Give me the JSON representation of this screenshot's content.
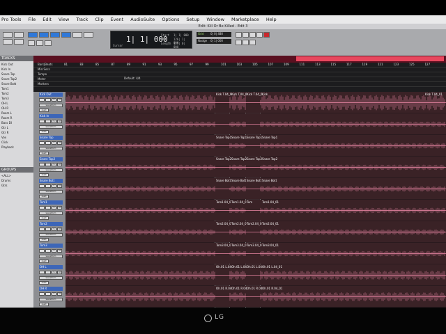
{
  "menu": {
    "items": [
      "Pro Tools",
      "File",
      "Edit",
      "View",
      "Track",
      "Clip",
      "Event",
      "AudioSuite",
      "Options",
      "Setup",
      "Window",
      "Marketplace",
      "Help"
    ]
  },
  "window": {
    "title": "Edit: Kill Or Be Killed - Edit 3"
  },
  "counter": {
    "main": "1| 1| 000",
    "cursor_label": "Cursor",
    "start_label": "Start",
    "end_label": "End",
    "length_label": "Length",
    "start_value": "1| 1| 000",
    "end_value": "126| 1| 000",
    "length_value": "125| 0| 000"
  },
  "nudge": {
    "label": "Nudge",
    "value": "0| 1| 000"
  },
  "grid": {
    "label": "Grid",
    "value": "0| 0| 480"
  },
  "tracks_panel": {
    "header": "TRACKS",
    "items": [
      "Kick Out",
      "Kick In",
      "Snare Top",
      "Snare Top2",
      "Snare Bott",
      "Tom1",
      "Tom2",
      "Tom3",
      "OH L",
      "OH R",
      "Room L",
      "Room R",
      "Bass DI",
      "Gtr L",
      "Gtr R",
      "Vox",
      "Click",
      "Playback"
    ]
  },
  "groups_panel": {
    "header": "GROUPS",
    "items": [
      "<ALL>",
      "Drums",
      "Gtrs"
    ]
  },
  "rulers": {
    "rows": [
      "Bars|Beats",
      "Min:Secs",
      "Tempo",
      "Meter",
      "Markers"
    ],
    "bar_numbers": [
      "81",
      "83",
      "85",
      "87",
      "89",
      "91",
      "93",
      "95",
      "97",
      "99",
      "101",
      "103",
      "105",
      "107",
      "109",
      "111",
      "113",
      "115",
      "117",
      "119",
      "121",
      "123",
      "125",
      "127"
    ],
    "marker": "Default: 4/4"
  },
  "tracks": [
    {
      "name": "Kick Out",
      "clips": [
        "Kick T.04_0",
        "Kick T.04_0",
        "Kick T.04_0",
        "Kick",
        "Kick T.04_01"
      ]
    },
    {
      "name": "Kick In",
      "clips": []
    },
    {
      "name": "Snare Top",
      "clips": [
        "Snare Top1",
        "Snare Top1",
        "Snare Top1",
        "Snare Top1"
      ]
    },
    {
      "name": "Snare Top2",
      "clips": [
        "Snare Top2",
        "Snare Top2",
        "Snare Top2",
        "Snare Top2"
      ]
    },
    {
      "name": "Snare Bott",
      "clips": [
        "Snare Bott",
        "Snare Bott",
        "Snare Bott",
        "Snare Bott"
      ]
    },
    {
      "name": "Tom1",
      "clips": [
        "Tom1.04_0",
        "Tom1.04_0",
        "Tom",
        "Tom1.04_01"
      ]
    },
    {
      "name": "Tom2",
      "clips": [
        "Tom2.04_0",
        "Tom2.04_0",
        "Tom2.04_0",
        "Tom2.04_01"
      ]
    },
    {
      "name": "Tom3",
      "clips": [
        "Tom3.04_0",
        "Tom3.04_0",
        "Tom3.04_0",
        "Tom3.04_01"
      ]
    },
    {
      "name": "OH L",
      "clips": [
        "Oh.01 L.04",
        "Oh.01 L.04",
        "Oh.01 L.04",
        "Oh.01 L.04_01"
      ]
    },
    {
      "name": "OH R",
      "clips": [
        "Oh.01 R.04",
        "Oh.01 R.04",
        "Oh.01 R.04",
        "Oh.01 R.04_01"
      ]
    }
  ],
  "track_buttons": {
    "rec": "rec",
    "input": "input",
    "solo": "S",
    "mute": "M",
    "view": "waveform",
    "dyn": "dyn",
    "read": "read"
  },
  "monitor": {
    "brand": "LG"
  },
  "colors": {
    "clip_fill": "#3a2226",
    "waveform": "#f18aa8",
    "track_name_bg": "#3d66b8",
    "ruler_red": "#e8475e"
  }
}
